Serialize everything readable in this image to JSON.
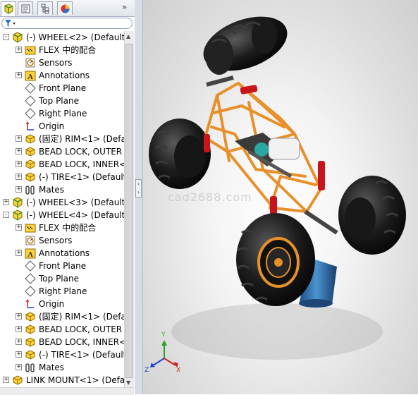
{
  "tabs": [
    {
      "name": "feature-manager",
      "active": true
    },
    {
      "name": "property-manager",
      "active": false
    },
    {
      "name": "configuration-manager",
      "active": false
    },
    {
      "name": "display-manager",
      "active": false
    }
  ],
  "more_glyph": "»",
  "filter_icon": "funnel-icon",
  "tree": [
    {
      "level": 0,
      "expander": "-",
      "icon": "assembly-icon",
      "label": "(-) WHEEL<2> (Default<"
    },
    {
      "level": 1,
      "expander": "+",
      "icon": "mate-folder-icon",
      "label": "FLEX 中的配合"
    },
    {
      "level": 1,
      "expander": "",
      "icon": "sensor-icon",
      "label": "Sensors"
    },
    {
      "level": 1,
      "expander": "+",
      "icon": "annotation-icon",
      "label": "Annotations"
    },
    {
      "level": 1,
      "expander": "",
      "icon": "plane-icon",
      "label": "Front Plane"
    },
    {
      "level": 1,
      "expander": "",
      "icon": "plane-icon",
      "label": "Top Plane"
    },
    {
      "level": 1,
      "expander": "",
      "icon": "plane-icon",
      "label": "Right Plane"
    },
    {
      "level": 1,
      "expander": "",
      "icon": "origin-icon",
      "label": "Origin"
    },
    {
      "level": 1,
      "expander": "+",
      "icon": "part-icon",
      "label": "(固定) RIM<1> (Defa"
    },
    {
      "level": 1,
      "expander": "+",
      "icon": "part-icon",
      "label": "BEAD LOCK, OUTER"
    },
    {
      "level": 1,
      "expander": "+",
      "icon": "part-icon",
      "label": "BEAD LOCK, INNER<"
    },
    {
      "level": 1,
      "expander": "+",
      "icon": "part-icon",
      "label": "(-) TIRE<1> (Default"
    },
    {
      "level": 1,
      "expander": "+",
      "icon": "mates-icon",
      "label": "Mates"
    },
    {
      "level": 0,
      "expander": "+",
      "icon": "assembly-icon",
      "label": "(-) WHEEL<3> (Default<"
    },
    {
      "level": 0,
      "expander": "-",
      "icon": "assembly-icon",
      "label": "(-) WHEEL<4> (Default<"
    },
    {
      "level": 1,
      "expander": "+",
      "icon": "mate-folder-icon",
      "label": "FLEX 中的配合"
    },
    {
      "level": 1,
      "expander": "",
      "icon": "sensor-icon",
      "label": "Sensors"
    },
    {
      "level": 1,
      "expander": "+",
      "icon": "annotation-icon",
      "label": "Annotations"
    },
    {
      "level": 1,
      "expander": "",
      "icon": "plane-icon",
      "label": "Front Plane"
    },
    {
      "level": 1,
      "expander": "",
      "icon": "plane-icon",
      "label": "Top Plane"
    },
    {
      "level": 1,
      "expander": "",
      "icon": "plane-icon",
      "label": "Right Plane"
    },
    {
      "level": 1,
      "expander": "",
      "icon": "origin-icon",
      "label": "Origin"
    },
    {
      "level": 1,
      "expander": "+",
      "icon": "part-icon",
      "label": "(固定) RIM<1> (Defa"
    },
    {
      "level": 1,
      "expander": "+",
      "icon": "part-icon",
      "label": "BEAD LOCK, OUTER"
    },
    {
      "level": 1,
      "expander": "+",
      "icon": "part-icon",
      "label": "BEAD LOCK, INNER<"
    },
    {
      "level": 1,
      "expander": "+",
      "icon": "part-icon",
      "label": "(-) TIRE<1> (Default"
    },
    {
      "level": 1,
      "expander": "+",
      "icon": "mates-icon",
      "label": "Mates"
    },
    {
      "level": 0,
      "expander": "+",
      "icon": "part-icon",
      "label": "LINK MOUNT<1> (Defa"
    }
  ],
  "viewport": {
    "watermark": "cad2688.com",
    "triad": {
      "x": "X",
      "y": "Y",
      "z": "Z"
    },
    "colors": {
      "frame": "#e8902a",
      "tire": "#1a1a1a",
      "shock": "#c8141c",
      "body": "#2a6fa8"
    }
  }
}
